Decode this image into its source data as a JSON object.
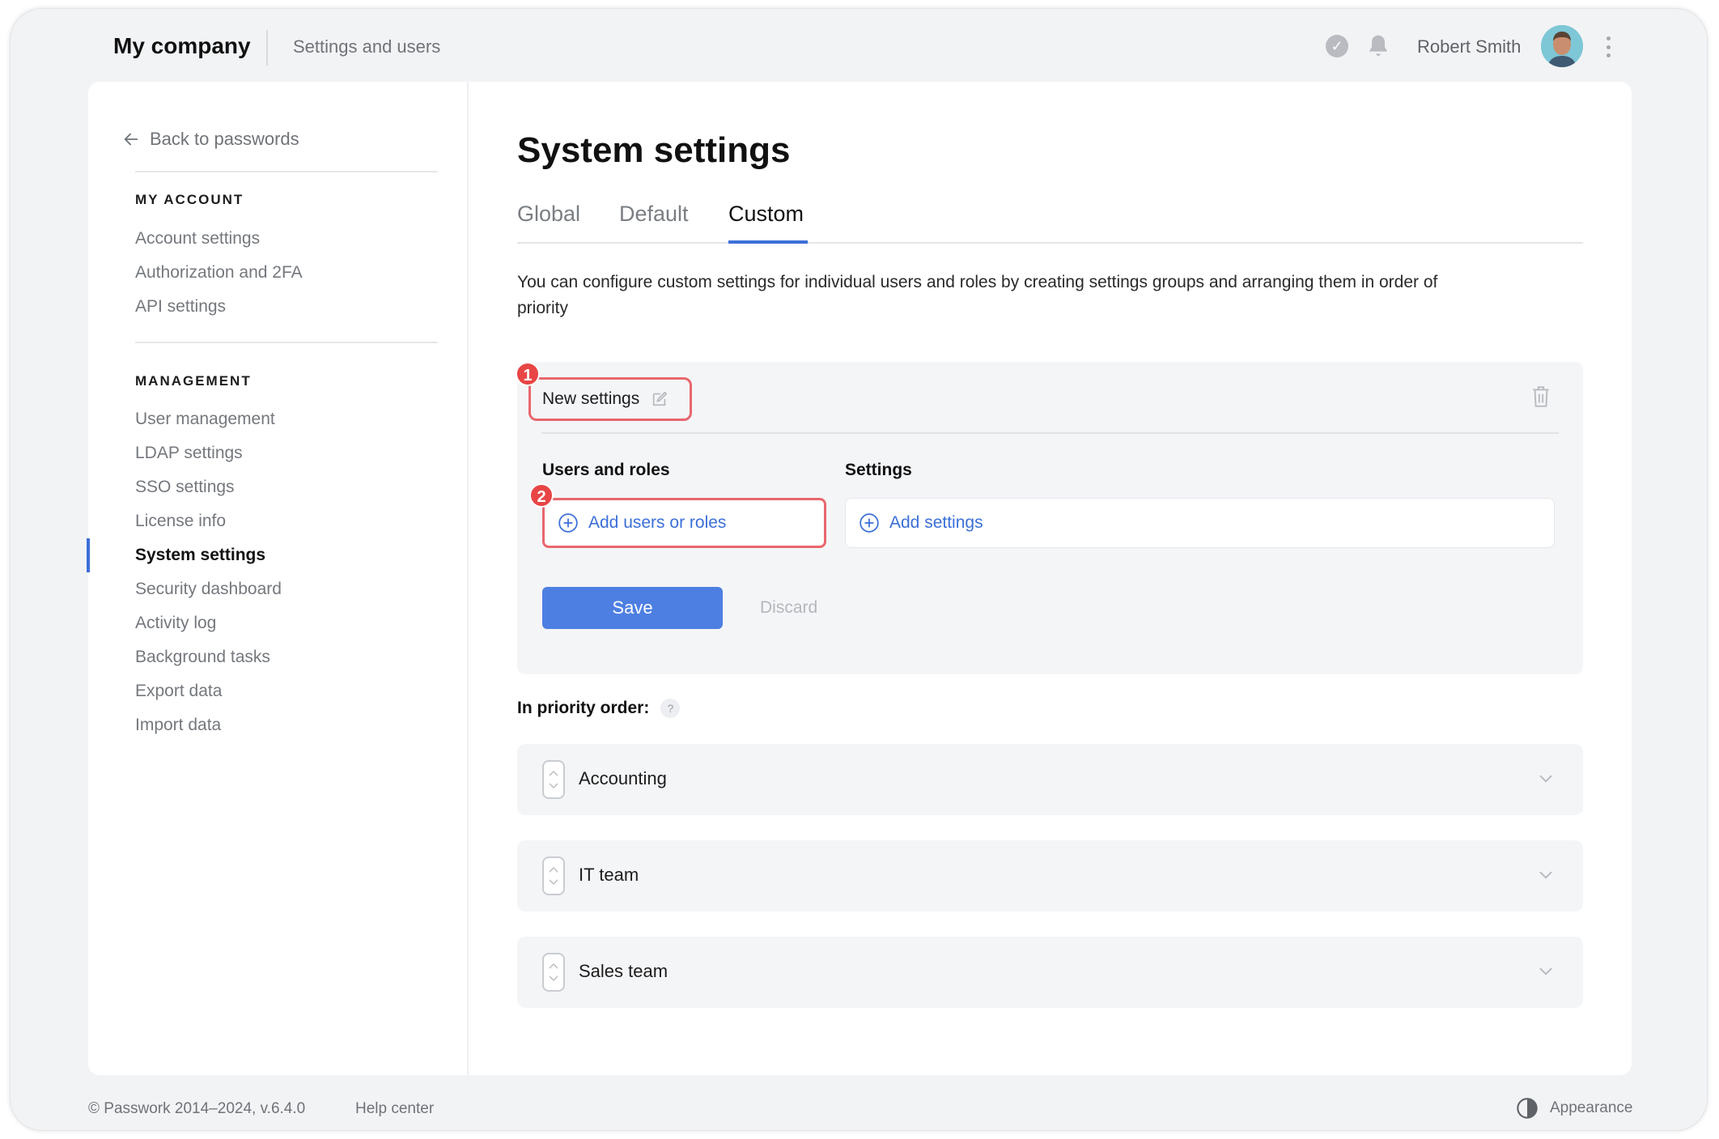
{
  "header": {
    "brand": "My company",
    "breadcrumb": "Settings and users",
    "user_name": "Robert Smith",
    "icons": [
      "check-circle-icon",
      "bell-icon",
      "avatar",
      "kebab-menu-icon"
    ]
  },
  "sidebar": {
    "back_label": "Back to passwords",
    "my_account_heading": "MY ACCOUNT",
    "my_account_items": [
      {
        "label": "Account settings"
      },
      {
        "label": "Authorization and 2FA"
      },
      {
        "label": "API settings"
      }
    ],
    "management_heading": "MANAGEMENT",
    "management_items": [
      {
        "label": "User management"
      },
      {
        "label": "LDAP settings"
      },
      {
        "label": "SSO settings"
      },
      {
        "label": "License info"
      },
      {
        "label": "System settings"
      },
      {
        "label": "Security dashboard"
      },
      {
        "label": "Activity log"
      },
      {
        "label": "Background tasks"
      },
      {
        "label": "Export data"
      },
      {
        "label": "Import data"
      }
    ],
    "active_item": "System settings"
  },
  "main": {
    "title": "System settings",
    "tabs": [
      {
        "label": "Global"
      },
      {
        "label": "Default"
      },
      {
        "label": "Custom"
      }
    ],
    "active_tab": "Custom",
    "description": "You can configure custom settings for individual users and roles by creating settings groups and arranging them in order of priority"
  },
  "group_editor": {
    "name": "New settings",
    "badge_1": "1",
    "badge_2": "2",
    "users_label": "Users and roles",
    "settings_label": "Settings",
    "add_users_label": "Add users or roles",
    "add_settings_label": "Add settings",
    "save_label": "Save",
    "discard_label": "Discard"
  },
  "priority": {
    "label": "In priority order:",
    "help": "?",
    "groups": [
      {
        "name": "Accounting"
      },
      {
        "name": "IT team"
      },
      {
        "name": "Sales team"
      }
    ]
  },
  "footer": {
    "copyright": "© Passwork 2014–2024, v.6.4.0",
    "help_center": "Help center",
    "appearance": "Appearance"
  },
  "colors": {
    "accent": "#3b6fd8",
    "save_button": "#4d7fe2",
    "highlight_red": "#e8676d",
    "badge_red": "#e84545"
  }
}
